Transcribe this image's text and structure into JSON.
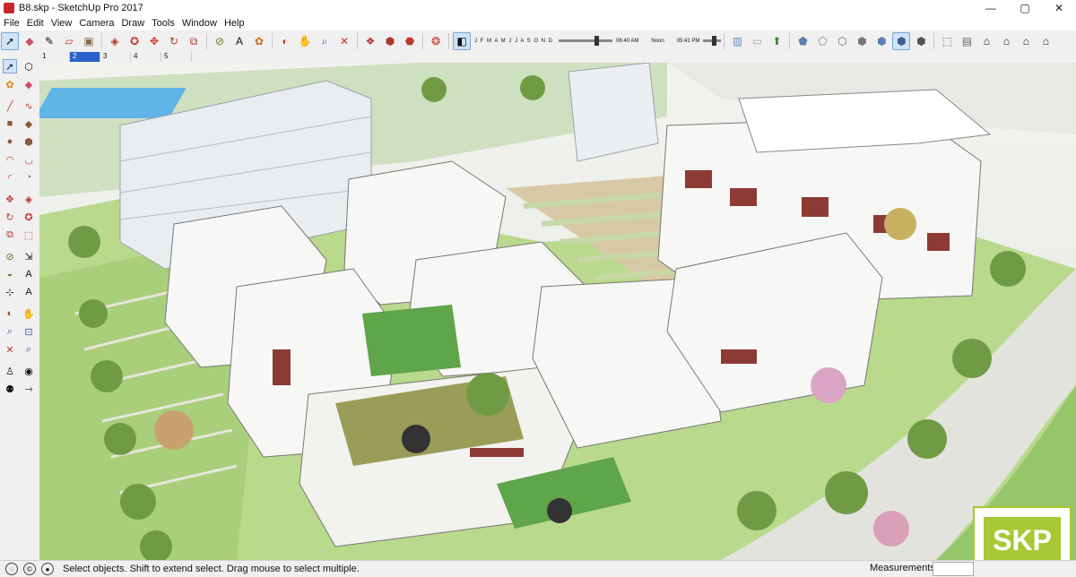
{
  "window": {
    "title": "B8.skp - SketchUp Pro 2017",
    "minimize": "—",
    "maximize": "▢",
    "close": "✕"
  },
  "menu": [
    "File",
    "Edit",
    "View",
    "Camera",
    "Draw",
    "Tools",
    "Window",
    "Help"
  ],
  "shadow": {
    "months": "J F M A M J J A S O N D",
    "time_start": "06:40 AM",
    "time_mid": "Noon",
    "time_end": "05:41 PM"
  },
  "scenes": [
    "1",
    "2",
    "3",
    "4",
    "5"
  ],
  "status": {
    "text": "Select objects. Shift to extend select. Drag mouse to select multiple.",
    "measurements_label": "Measurements"
  },
  "badge": {
    "text": "SKP"
  },
  "colors": {
    "accent": "#2a62c8",
    "brand": "#a6c935",
    "grass": "#a9cf7a",
    "building": "#f7f7f5",
    "brick": "#8c3b34"
  }
}
